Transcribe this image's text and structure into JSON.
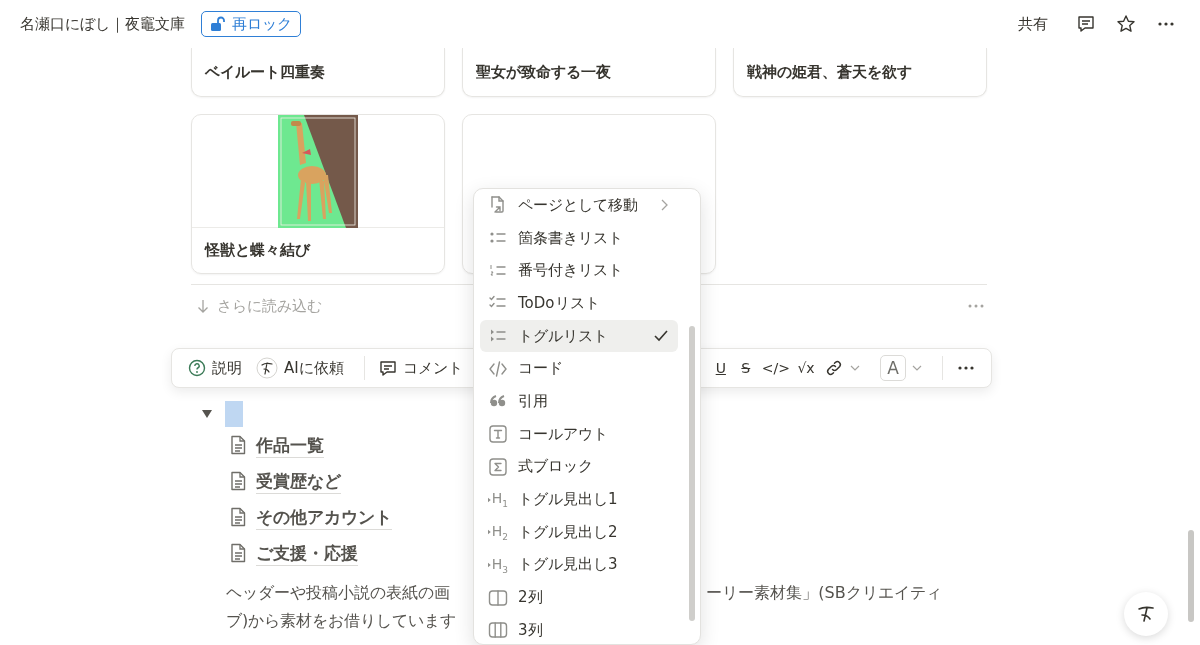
{
  "topbar": {
    "title": "名瀬口にぼし｜夜竈文庫",
    "lock_button": "再ロック",
    "share": "共有"
  },
  "gallery": {
    "cards": [
      {
        "kind": "title_only",
        "title": "ベイルート四重奏"
      },
      {
        "kind": "title_only",
        "title": "聖女が致命する一夜"
      },
      {
        "kind": "title_only",
        "title": "戦神の姫君、蒼天を欲す"
      },
      {
        "kind": "cover",
        "title": "怪獣と蝶々結び"
      },
      {
        "kind": "empty"
      }
    ],
    "load_more": "さらに読み込む"
  },
  "toolbar": {
    "left": [
      {
        "kind": "help",
        "label": "説明"
      },
      {
        "kind": "ai",
        "label": "AIに依頼"
      },
      {
        "kind": "comment",
        "label": "コメント"
      }
    ],
    "right": [
      {
        "kind": "underline",
        "label": "U"
      },
      {
        "kind": "strike",
        "label": "S"
      },
      {
        "kind": "plain",
        "label": "</>"
      },
      {
        "kind": "plain",
        "label": "√x"
      },
      {
        "kind": "link"
      },
      {
        "kind": "color",
        "label": "A"
      },
      {
        "kind": "more"
      }
    ]
  },
  "toggle": {
    "expanded": true,
    "children": [
      {
        "title": "作品一覧"
      },
      {
        "title": "受賞歴など"
      },
      {
        "title": "その他アカウント"
      },
      {
        "title": "ご支援・応援"
      }
    ]
  },
  "paragraph": {
    "left_lines": [
      "ヘッダーや投稿小説の表紙の画",
      "ブ)から素材をお借りしています"
    ],
    "right_lines": [
      "ーリー素材集」(SBクリエイティ"
    ]
  },
  "menu": {
    "items": [
      {
        "kind": "page",
        "label": "ページとして移動",
        "submenu": true,
        "selected": false
      },
      {
        "kind": "bullet",
        "label": "箇条書きリスト",
        "submenu": false,
        "selected": false
      },
      {
        "kind": "numbered",
        "label": "番号付きリスト",
        "submenu": false,
        "selected": false
      },
      {
        "kind": "todo",
        "label": "ToDoリスト",
        "submenu": false,
        "selected": false
      },
      {
        "kind": "toggle",
        "label": "トグルリスト",
        "submenu": false,
        "selected": true
      },
      {
        "kind": "code",
        "label": "コード",
        "submenu": false,
        "selected": false
      },
      {
        "kind": "quote",
        "label": "引用",
        "submenu": false,
        "selected": false
      },
      {
        "kind": "callout",
        "label": "コールアウト",
        "submenu": false,
        "selected": false
      },
      {
        "kind": "equation",
        "label": "式ブロック",
        "submenu": false,
        "selected": false
      },
      {
        "kind": "heading",
        "icon_text": "H$_{1}$",
        "label": "トグル見出し1",
        "submenu": false,
        "selected": false
      },
      {
        "kind": "heading",
        "icon_text": "H$_{2}$",
        "label": "トグル見出し2",
        "submenu": false,
        "selected": false
      },
      {
        "kind": "heading",
        "icon_text": "H$_{3}$",
        "label": "トグル見出し3",
        "submenu": false,
        "selected": false
      },
      {
        "kind": "col2",
        "label": "2列",
        "submenu": false,
        "selected": false
      },
      {
        "kind": "col3",
        "label": "3列",
        "submenu": false,
        "selected": false
      }
    ]
  }
}
